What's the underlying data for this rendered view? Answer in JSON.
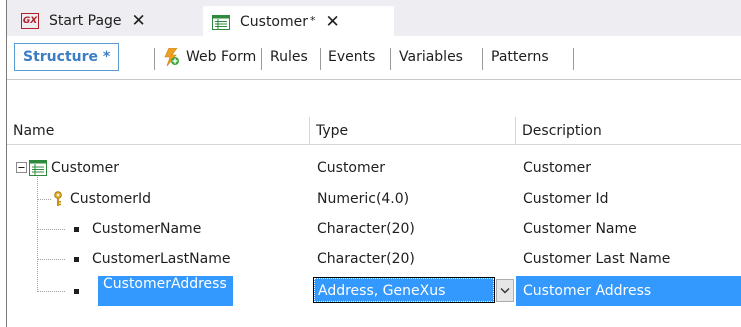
{
  "tabs": [
    {
      "label": "Start Page",
      "icon": "gx-logo-icon"
    },
    {
      "label": "Customer",
      "modified_mark": "*",
      "icon": "transaction-icon"
    }
  ],
  "subtabs": {
    "structure": "Structure *",
    "web_form": "Web Form",
    "rules": "Rules",
    "events": "Events",
    "variables": "Variables",
    "patterns": "Patterns"
  },
  "columns": {
    "name": "Name",
    "type": "Type",
    "description": "Description"
  },
  "rows": [
    {
      "name": "Customer",
      "type": "Customer",
      "description": "Customer",
      "kind": "root"
    },
    {
      "name": "CustomerId",
      "type": "Numeric(4.0)",
      "description": "Customer Id",
      "kind": "key"
    },
    {
      "name": "CustomerName",
      "type": "Character(20)",
      "description": "Customer Name",
      "kind": "attribute"
    },
    {
      "name": "CustomerLastName",
      "type": "Character(20)",
      "description": "Customer Last Name",
      "kind": "attribute"
    },
    {
      "name": "CustomerAddress",
      "type": "Address, GeneXus",
      "description": "Customer Address",
      "kind": "attribute",
      "selected": true
    }
  ],
  "colors": {
    "selection": "#3399ff",
    "accent": "#3c7dc4"
  }
}
